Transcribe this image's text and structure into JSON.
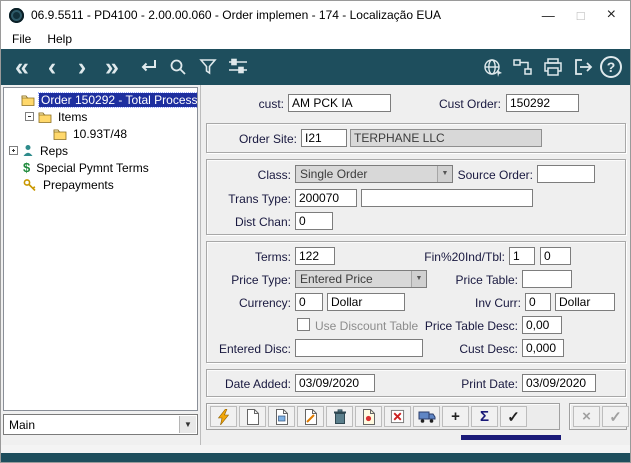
{
  "window": {
    "title": "06.9.5511 - PD4100 - 2.00.00.060 - Order implemen - 174 - Localização EUA"
  },
  "menu": {
    "file": "File",
    "help": "Help"
  },
  "glyphs": {
    "first": "«",
    "previous": "‹",
    "next": "›",
    "last": "»",
    "dropdown": "▼",
    "minimize": "—",
    "maximize": "□",
    "close": "×",
    "add": "+",
    "sum": "Σ",
    "check": "✓",
    "cross": "×",
    "question": "?",
    "dollar": "$"
  },
  "toolbar": {
    "left_icons": [
      "first-icon",
      "previous-icon",
      "next-icon",
      "last-icon",
      "enter-icon",
      "search-icon",
      "filter-icon",
      "options-icon"
    ],
    "right_icons": [
      "web-icon",
      "connection-icon",
      "print-icon",
      "exit-icon",
      "help-icon"
    ]
  },
  "tree": {
    "root": "Order 150292 - Total Process",
    "items_node": "Items",
    "item_child": "10.93T/48",
    "reps": "Reps",
    "special_pymnt": "Special Pymnt Terms",
    "prepayments": "Prepayments"
  },
  "panel_selector": {
    "value": "Main"
  },
  "form": {
    "cust": {
      "label": "cust:",
      "value": "AM PCK IA"
    },
    "cust_order": {
      "label": "Cust Order:",
      "value": "150292"
    },
    "order_site": {
      "label": "Order Site:",
      "code": "I21",
      "name": "TERPHANE LLC"
    },
    "class": {
      "label": "Class:",
      "value": "Single Order"
    },
    "source_order": {
      "label": "Source Order:",
      "value": ""
    },
    "trans_type": {
      "label": "Trans Type:",
      "value": "200070",
      "desc": ""
    },
    "dist_chan": {
      "label": "Dist Chan:",
      "value": "0"
    },
    "terms": {
      "label": "Terms:",
      "value": "122"
    },
    "fin_ind_tbl": {
      "label": "Fin%20Ind/Tbl:",
      "ind": "1",
      "tbl": "0"
    },
    "price_type": {
      "label": "Price Type:",
      "value": "Entered Price"
    },
    "price_table": {
      "label": "Price Table:",
      "value": ""
    },
    "currency": {
      "label": "Currency:",
      "code": "0",
      "name": "Dollar"
    },
    "inv_curr": {
      "label": "Inv Curr:",
      "code": "0",
      "name": "Dollar"
    },
    "use_discount_table": {
      "label": "Use Discount Table",
      "checked": false
    },
    "price_table_desc": {
      "label": "Price Table Desc:",
      "value": "0,00"
    },
    "entered_disc": {
      "label": "Entered Disc:",
      "value": ""
    },
    "cust_desc": {
      "label": "Cust Desc:",
      "value": "0,000"
    },
    "date_added": {
      "label": "Date Added:",
      "value": "03/09/2020"
    },
    "print_date": {
      "label": "Print Date:",
      "value": "03/09/2020"
    }
  },
  "action_bar": {
    "buttons": [
      "execute",
      "new-document",
      "picture-document",
      "edit-document",
      "delete",
      "alert-document",
      "close-box",
      "ship",
      "add",
      "sum",
      "confirm"
    ],
    "disabled_buttons": [
      "cancel",
      "ok"
    ]
  },
  "colors": {
    "toolbar": "#1e4e5d",
    "tree_selection": "#1e2f9f",
    "progress_line": "#1a1a78",
    "disabled_field": "#d8d8d8"
  }
}
